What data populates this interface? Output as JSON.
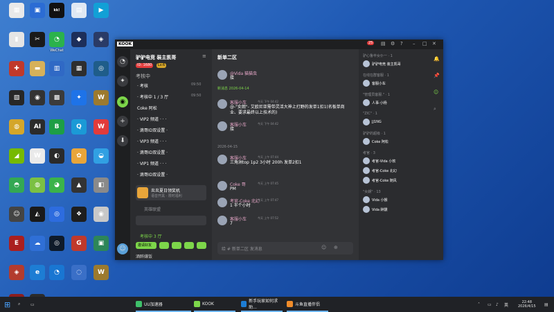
{
  "desktop": {
    "icons": [
      {
        "label": "",
        "color": "#e9e9e9",
        "glyph": "▦"
      },
      {
        "label": "",
        "color": "#2b6cd4",
        "glyph": "▣"
      },
      {
        "label": "",
        "color": "#111111",
        "glyph": "kk!"
      },
      {
        "label": "",
        "color": "#dfe8f3",
        "glyph": "▤"
      },
      {
        "label": "",
        "color": "#12a0d6",
        "glyph": "▶"
      },
      {
        "label": "",
        "color": "#e5e5e5",
        "glyph": "▮"
      },
      {
        "label": "",
        "color": "#1a1a1a",
        "glyph": "✂"
      },
      {
        "label": "WeChat",
        "color": "#2bb24c",
        "glyph": "◔"
      },
      {
        "label": "",
        "color": "#1d2f5a",
        "glyph": "◆"
      },
      {
        "label": "",
        "color": "#2a3b66",
        "glyph": "◈"
      },
      {
        "label": "",
        "color": "#c0392b",
        "glyph": "✚"
      },
      {
        "label": "",
        "color": "#d6b15a",
        "glyph": "▬"
      },
      {
        "label": "",
        "color": "#3069c5",
        "glyph": "▥"
      },
      {
        "label": "",
        "color": "#2e2e2e",
        "glyph": "▦"
      },
      {
        "label": "",
        "color": "#1f5d8a",
        "glyph": "◎"
      },
      {
        "label": "",
        "color": "#272727",
        "glyph": "▧"
      },
      {
        "label": "",
        "color": "#333333",
        "glyph": "◉"
      },
      {
        "label": "",
        "color": "#3b3b3b",
        "glyph": "▩"
      },
      {
        "label": "",
        "color": "#1e73e8",
        "glyph": "✦"
      },
      {
        "label": "",
        "color": "#9c7a2e",
        "glyph": "W"
      },
      {
        "label": "",
        "color": "#d4a62a",
        "glyph": "◍"
      },
      {
        "label": "",
        "color": "#2b2b2b",
        "glyph": "AI"
      },
      {
        "label": "",
        "color": "#1d9e45",
        "glyph": "B"
      },
      {
        "label": "",
        "color": "#1b9ad6",
        "glyph": "Q"
      },
      {
        "label": "",
        "color": "#e23b3b",
        "glyph": "W"
      },
      {
        "label": "",
        "color": "#76b900",
        "glyph": "◢"
      },
      {
        "label": "",
        "color": "#eaeaea",
        "glyph": "W"
      },
      {
        "label": "",
        "color": "#2a2a2a",
        "glyph": "◐"
      },
      {
        "label": "",
        "color": "#e8a53a",
        "glyph": "✿"
      },
      {
        "label": "",
        "color": "#31a0e3",
        "glyph": "◒"
      },
      {
        "label": "",
        "color": "#34a853",
        "glyph": "◓"
      },
      {
        "label": "",
        "color": "#7bc043",
        "glyph": "◍"
      },
      {
        "label": "",
        "color": "#3bb34a",
        "glyph": "◕"
      },
      {
        "label": "",
        "color": "#333333",
        "glyph": "▲"
      },
      {
        "label": "",
        "color": "#8a8a8a",
        "glyph": "◧"
      },
      {
        "label": "",
        "color": "#444444",
        "glyph": "☺"
      },
      {
        "label": "",
        "color": "#1a1a1a",
        "glyph": "◭"
      },
      {
        "label": "",
        "color": "#2d6cdf",
        "glyph": "◎"
      },
      {
        "label": "",
        "color": "#1e1e1e",
        "glyph": "❖"
      },
      {
        "label": "",
        "color": "#c8c8c8",
        "glyph": "◉"
      },
      {
        "label": "",
        "color": "#aa1f1f",
        "glyph": "E"
      },
      {
        "label": "",
        "color": "#2f6fd6",
        "glyph": "☁"
      },
      {
        "label": "",
        "color": "#0f1b2a",
        "glyph": "◎"
      },
      {
        "label": "",
        "color": "#c0392b",
        "glyph": "G"
      },
      {
        "label": "",
        "color": "#2d8659",
        "glyph": "▣"
      },
      {
        "label": "",
        "color": "#b33b2e",
        "glyph": "◈"
      },
      {
        "label": "",
        "color": "#1d7dd4",
        "glyph": "e"
      },
      {
        "label": "",
        "color": "#1976d2",
        "glyph": "◔"
      },
      {
        "label": "",
        "color": "#3a6fc7",
        "glyph": "◌"
      },
      {
        "label": "",
        "color": "#9c7a2e",
        "glyph": "W"
      },
      {
        "label": "",
        "color": "#8b1e1e",
        "glyph": "◆"
      },
      {
        "label": "",
        "color": "#2b2b2b",
        "glyph": "KOOK"
      }
    ]
  },
  "window": {
    "logo": "KOOK",
    "badge_count": "25"
  },
  "server": {
    "name": "驴驴电竞 装主凯哥",
    "id_badge": "ID: 1680",
    "level_badge": "Lv.6",
    "group_title": "考核中",
    "online_pill": "在线",
    "channels": [
      {
        "name": "· 考核",
        "time": "09:50"
      },
      {
        "name": "· 考核中 1 / 3 厅",
        "time": "09:50"
      },
      {
        "name": "Coke 阿松",
        "time": ""
      },
      {
        "name": "· VIP2 频道 · · ·",
        "time": ""
      },
      {
        "name": "· 滴哥ID双设置 ·",
        "time": ""
      },
      {
        "name": "· VIP3 频道 · · ·",
        "time": ""
      },
      {
        "name": "· 滴哥ID双设置 ·",
        "time": ""
      },
      {
        "name": "· VIP1 频道 · · ·",
        "time": ""
      },
      {
        "name": "· 滴哥ID双设置 ·",
        "time": ""
      }
    ],
    "voice_card_title": "炎炎夏日领奖机",
    "voice_card_sub": "语音开黑 · 限时福利",
    "game_label": "英雄联盟",
    "voice_status": "考核中 3 厅",
    "invite_label": "邀请好友",
    "user_name": "酒醉嫌饭"
  },
  "chat": {
    "channel_title": "新单二区",
    "messages": [
      {
        "author": "@Vida 猫猫虫",
        "time": "",
        "text": "接"
      },
      {
        "author": "新消息 2026-04-14",
        "time": "",
        "text": ""
      },
      {
        "author": "客服小车",
        "time": "今天 下午 04:42",
        "text": "@-\"女朗\"- 艾欧尼亚需带灵活大神上打野的发单1扣1(名板单商业、要求最终以上技术的)"
      },
      {
        "author": "客服小车",
        "time": "今天 下午 04:42",
        "text": "接"
      },
      {
        "author": "2026-04-15",
        "time": "",
        "text": ""
      },
      {
        "author": "客服小车",
        "time": "今天 上午 07:44",
        "text": "三角洲top 1p2 3小时 200h 发单2扣1"
      },
      {
        "author": "Coke 哥",
        "time": "今天 上午 07:45",
        "text": "PM"
      },
      {
        "author": "考官-Coke 北幻",
        "time": "今天 上午 07:47",
        "text": "1 半个小时"
      },
      {
        "author": "客服小车",
        "time": "今天 上午 07:52",
        "text": "7"
      }
    ],
    "input_placeholder": "给 # 新单二区 发消息"
  },
  "members": {
    "groups": [
      {
        "title": "驴心鲁卒女仆一 · 1",
        "items": [
          "驴驴电竞 装主凯哥"
        ]
      },
      {
        "title": "在线在群客服 · 1",
        "items": [
          "客服小车"
        ]
      },
      {
        "title": "\"管理员客服.\" · 1",
        "items": [
          "人事·小杨"
        ]
      },
      {
        "title": "\"ZIC\" · 1",
        "items": [
          "JJ1NG"
        ]
      },
      {
        "title": "驴驴的超级 · 1",
        "items": [
          "Coke 阿松"
        ]
      },
      {
        "title": "考官 · 3",
        "items": [
          "考官-Vida 小软",
          "考官-Coke 北幻",
          "考官-Coke 随风"
        ]
      },
      {
        "title": "\"女朗\" · 13",
        "items": [
          "Vida 小猴",
          "Vida 醉醺"
        ]
      }
    ]
  },
  "taskbar": {
    "apps": [
      "UU加速器",
      "KOOK",
      "新手玩家如何求助...",
      "斗鱼直播伴侣"
    ],
    "lang": "英",
    "time": "22:48",
    "date": "2026/4/15"
  },
  "colors": {
    "accent": "#7dd64a",
    "window_bg": "#2f3033",
    "sidebar_bg": "#1e1f21"
  }
}
